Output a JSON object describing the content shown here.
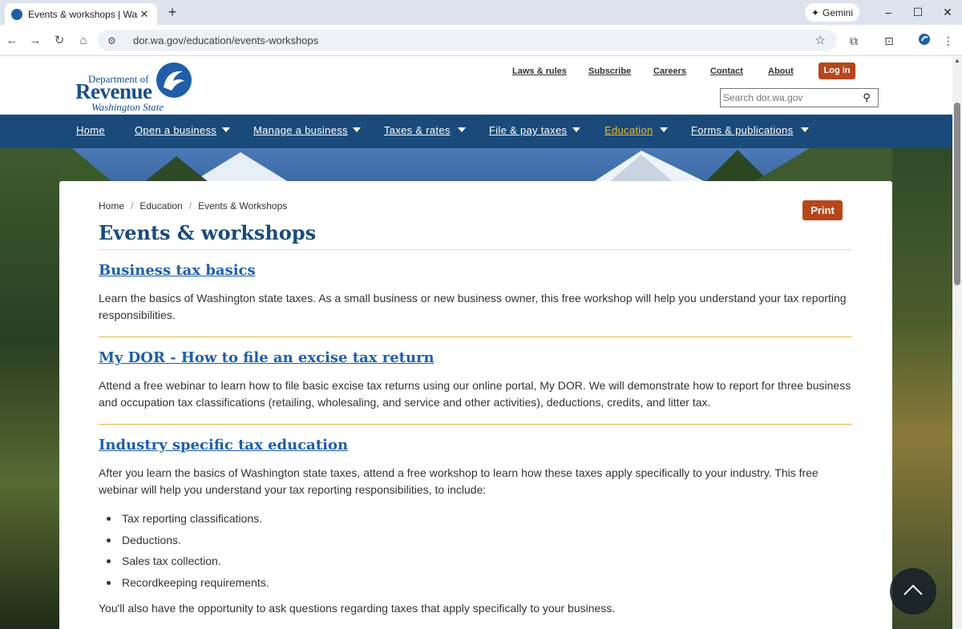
{
  "browser": {
    "tab_title": "Events & workshops | Washingt",
    "tab_close": "✕",
    "new_tab": "+",
    "gemini_label": "Gemini",
    "url": "dor.wa.gov/education/events-workshops"
  },
  "header": {
    "logo_line1": "Department of",
    "logo_line2": "Revenue",
    "logo_line3": "Washington State",
    "utility_links": [
      "Laws & rules",
      "Subscribe",
      "Careers",
      "Contact",
      "About"
    ],
    "login_label": "Log in",
    "search_placeholder": "Search dor.wa.gov"
  },
  "nav": {
    "items": [
      {
        "label": "Home"
      },
      {
        "label": "Open a business"
      },
      {
        "label": "Manage a business"
      },
      {
        "label": "Taxes & rates"
      },
      {
        "label": "File & pay taxes"
      },
      {
        "label": "Education"
      },
      {
        "label": "Forms & publications"
      }
    ],
    "active": "Education"
  },
  "breadcrumb": [
    "Home",
    "Education",
    "Events & Workshops"
  ],
  "print_label": "Print",
  "page_title": "Events & workshops",
  "sections": [
    {
      "title": "Business tax basics",
      "body": "Learn the basics of Washington state taxes. As a small business or new business owner, this free workshop will help you understand your tax reporting responsibilities."
    },
    {
      "title": "My DOR - How to file an excise tax return",
      "body": "Attend a free webinar to learn how to file basic excise tax returns using our online portal, My DOR. We will demonstrate how to report for three business and occupation tax classifications (retailing, wholesaling, and service and other activities), deductions, credits, and litter tax."
    },
    {
      "title": "Industry specific tax education",
      "body": "After you learn the basics of Washington state taxes, attend a free workshop to learn how these taxes apply specifically to your industry. This free webinar will help you understand your tax reporting responsibilities, to include:",
      "bullets": [
        "Tax reporting classifications.",
        "Deductions.",
        "Sales tax collection.",
        "Recordkeeping requirements."
      ],
      "footer": "You'll also have the opportunity to ask questions regarding taxes that apply specifically to your business."
    }
  ],
  "colors": {
    "nav_bg": "#1a4a7a",
    "accent_orange": "#b8461b",
    "link_blue": "#1f5fa8",
    "active_nav": "#f0b429",
    "divider_gold": "#e8b84a"
  }
}
